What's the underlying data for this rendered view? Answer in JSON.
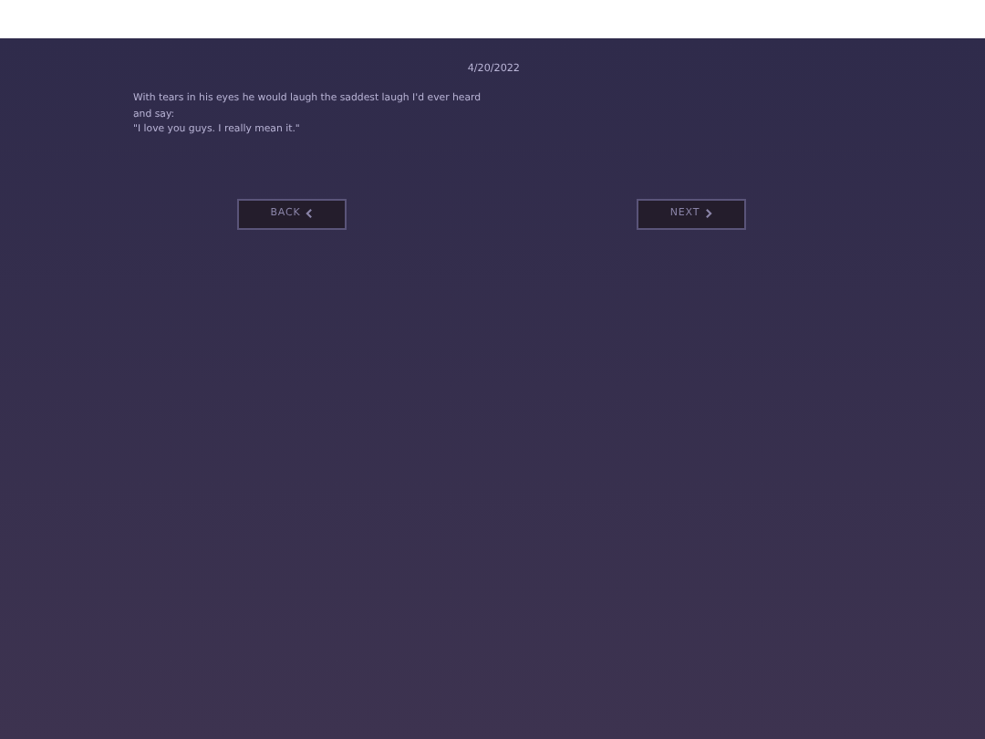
{
  "entry": {
    "date": "4/20/2022",
    "lines": [
      "With tears in his eyes he would laugh the saddest laugh I'd ever heard and say:",
      "\"I love you guys. I really mean it.\""
    ]
  },
  "navigation": [
    {
      "label": "BACK",
      "kind": "back"
    },
    {
      "label": "NEXT",
      "kind": "next"
    }
  ]
}
